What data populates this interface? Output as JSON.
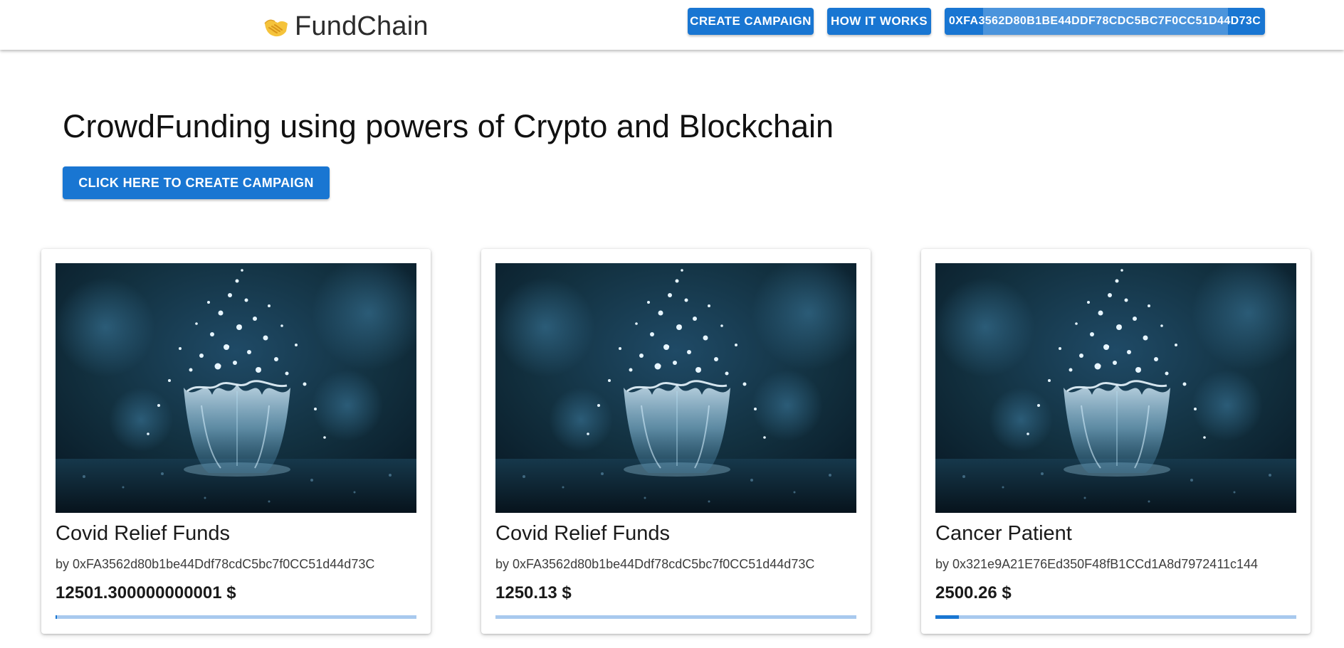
{
  "header": {
    "brand_name": "FundChain",
    "brand_icon": "handshake-icon",
    "create_campaign_label": "CREATE CAMPAIGN",
    "how_it_works_label": "HOW IT WORKS",
    "wallet_address_label": "0XFA3562D80B1BE44DDF78CDC5BC7F0CC51D44D73C"
  },
  "hero": {
    "title": "CrowdFunding using powers of Crypto and Blockchain",
    "cta_label": "CLICK HERE TO CREATE CAMPAIGN"
  },
  "campaigns": [
    {
      "title": "Covid Relief Funds",
      "author": "by 0xFA3562d80b1be44Ddf78cdC5bc7f0CC51d44d73C",
      "amount": "12501.300000000001 $",
      "progress": 0.004
    },
    {
      "title": "Covid Relief Funds",
      "author": "by 0xFA3562d80b1be44Ddf78cdC5bc7f0CC51d44d73C",
      "amount": "1250.13 $",
      "progress": 0
    },
    {
      "title": "Cancer Patient",
      "author": "by 0x321e9A21E76Ed350F48fB1CCd1A8d7972411c144",
      "amount": "2500.26 $",
      "progress": 0.065
    }
  ],
  "colors": {
    "primary": "#1976d2",
    "progress_track": "#a8c9ee"
  }
}
